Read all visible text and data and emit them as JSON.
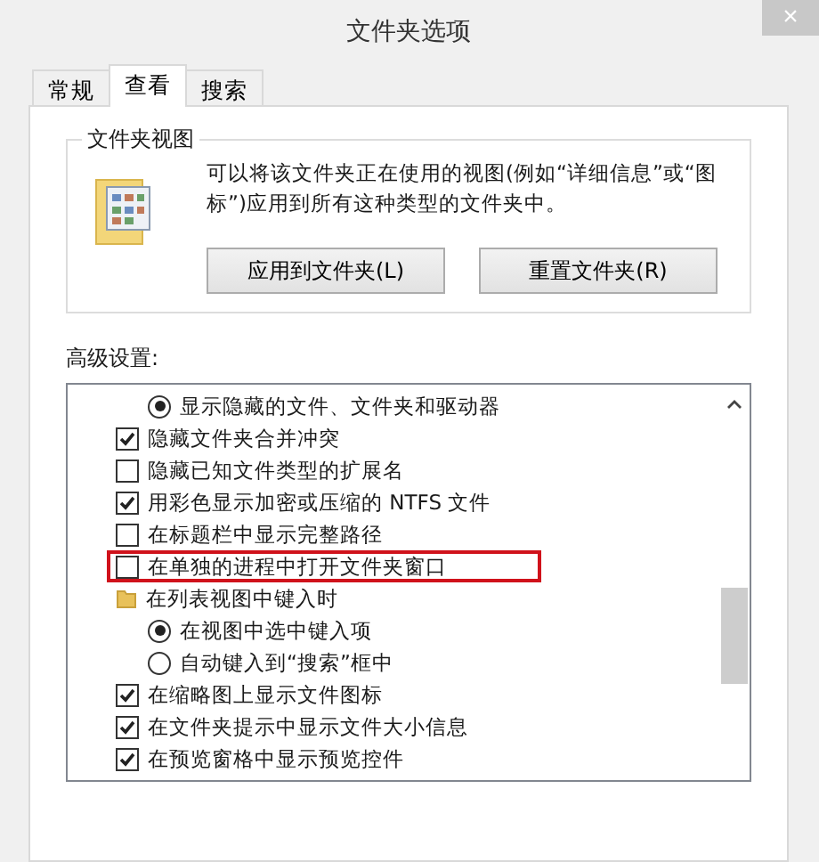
{
  "window": {
    "title": "文件夹选项",
    "close": "×"
  },
  "tabs": [
    {
      "label": "常规",
      "selected": false
    },
    {
      "label": "查看",
      "selected": true
    },
    {
      "label": "搜索",
      "selected": false
    }
  ],
  "folder_views": {
    "title": "文件夹视图",
    "description": "可以将该文件夹正在使用的视图(例如“详细信息”或“图标”)应用到所有这种类型的文件夹中。",
    "buttons": [
      "应用到文件夹(L)",
      "重置文件夹(R)"
    ]
  },
  "advanced": {
    "label": "高级设置:",
    "items": [
      {
        "kind": "radio",
        "label": "显示隐藏的文件、文件夹和驱动器",
        "selected": true
      },
      {
        "kind": "checkbox",
        "label": "隐藏文件夹合并冲突",
        "checked": true
      },
      {
        "kind": "checkbox",
        "label": "隐藏已知文件类型的扩展名",
        "checked": false
      },
      {
        "kind": "checkbox",
        "label": "用彩色显示加密或压缩的 NTFS 文件",
        "checked": true
      },
      {
        "kind": "checkbox",
        "label": "在标题栏中显示完整路径",
        "checked": false
      },
      {
        "kind": "checkbox",
        "label": "在单独的进程中打开文件夹窗口",
        "checked": false,
        "highlighted": true
      },
      {
        "kind": "folder",
        "label": "在列表视图中键入时",
        "children": [
          {
            "kind": "radio",
            "label": "在视图中选中键入项",
            "selected": true
          },
          {
            "kind": "radio",
            "label": "自动键入到“搜索”框中",
            "selected": false
          }
        ]
      },
      {
        "kind": "checkbox",
        "label": "在缩略图上显示文件图标",
        "checked": true
      },
      {
        "kind": "checkbox",
        "label": "在文件夹提示中显示文件大小信息",
        "checked": true
      },
      {
        "kind": "checkbox",
        "label": "在预览窗格中显示预览控件",
        "checked": true
      }
    ]
  }
}
